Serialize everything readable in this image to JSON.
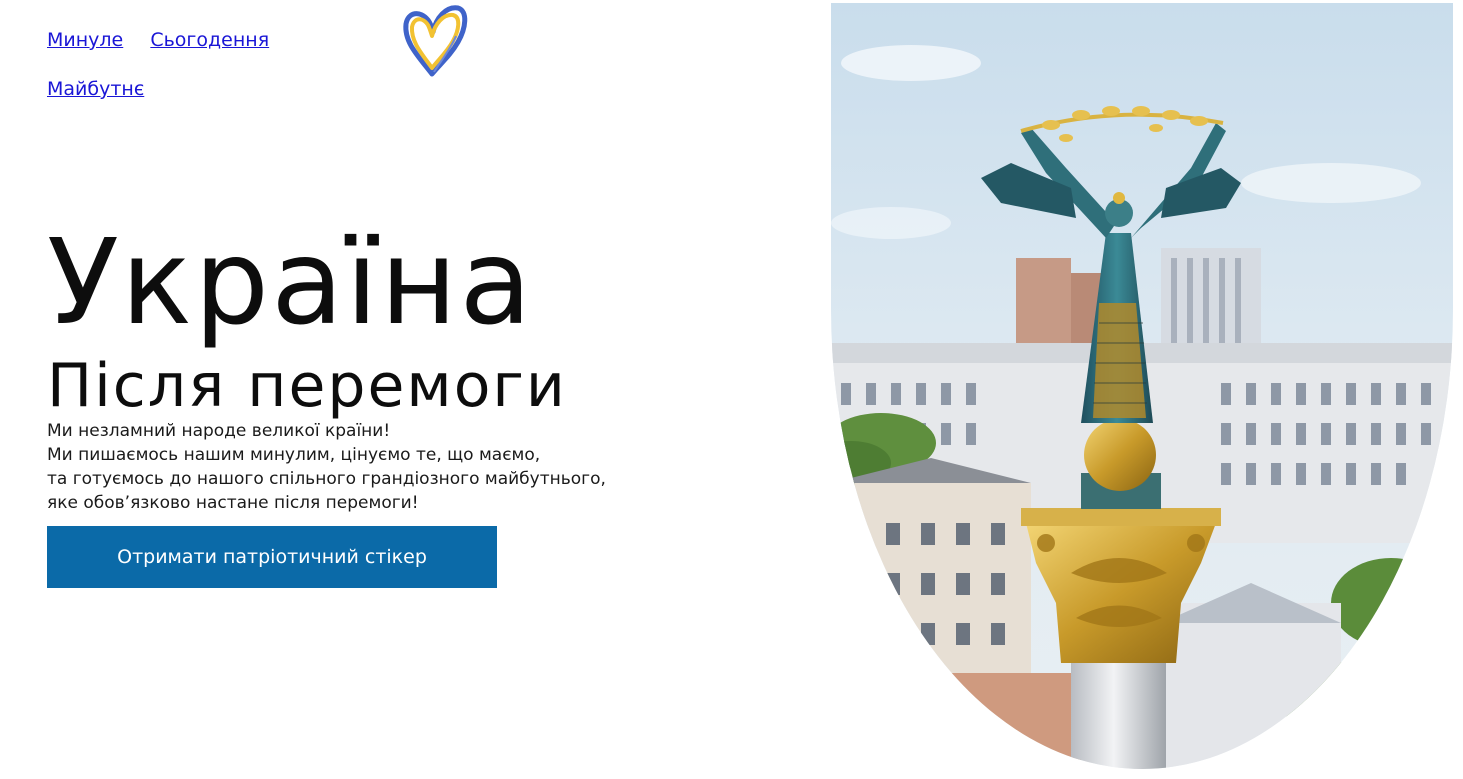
{
  "nav": {
    "items": [
      {
        "label": "Минуле"
      },
      {
        "label": "Сьогодення"
      },
      {
        "label": "Майбутнє"
      }
    ]
  },
  "logo": {
    "icon": "heart-icon",
    "colors": {
      "blue": "#3f63c9",
      "yellow": "#f2c232"
    }
  },
  "hero": {
    "title": "Україна",
    "subtitle": "Після перемоги",
    "paragraph_lines": [
      "Ми незламний народе великої країни!",
      "Ми пишаємось нашим минулим, цінуємо те, що маємо,",
      "та готуємось до нашого спільного грандіозного майбутнього,",
      "яке обов’язково настане після перемоги!"
    ],
    "cta_label": "Отримати патріотичний стікер"
  },
  "image": {
    "subject": "independence-monument-photo"
  },
  "colors": {
    "link": "#1a16d6",
    "cta_bg": "#0b6aa8",
    "cta_text": "#ffffff",
    "text": "#111111"
  }
}
